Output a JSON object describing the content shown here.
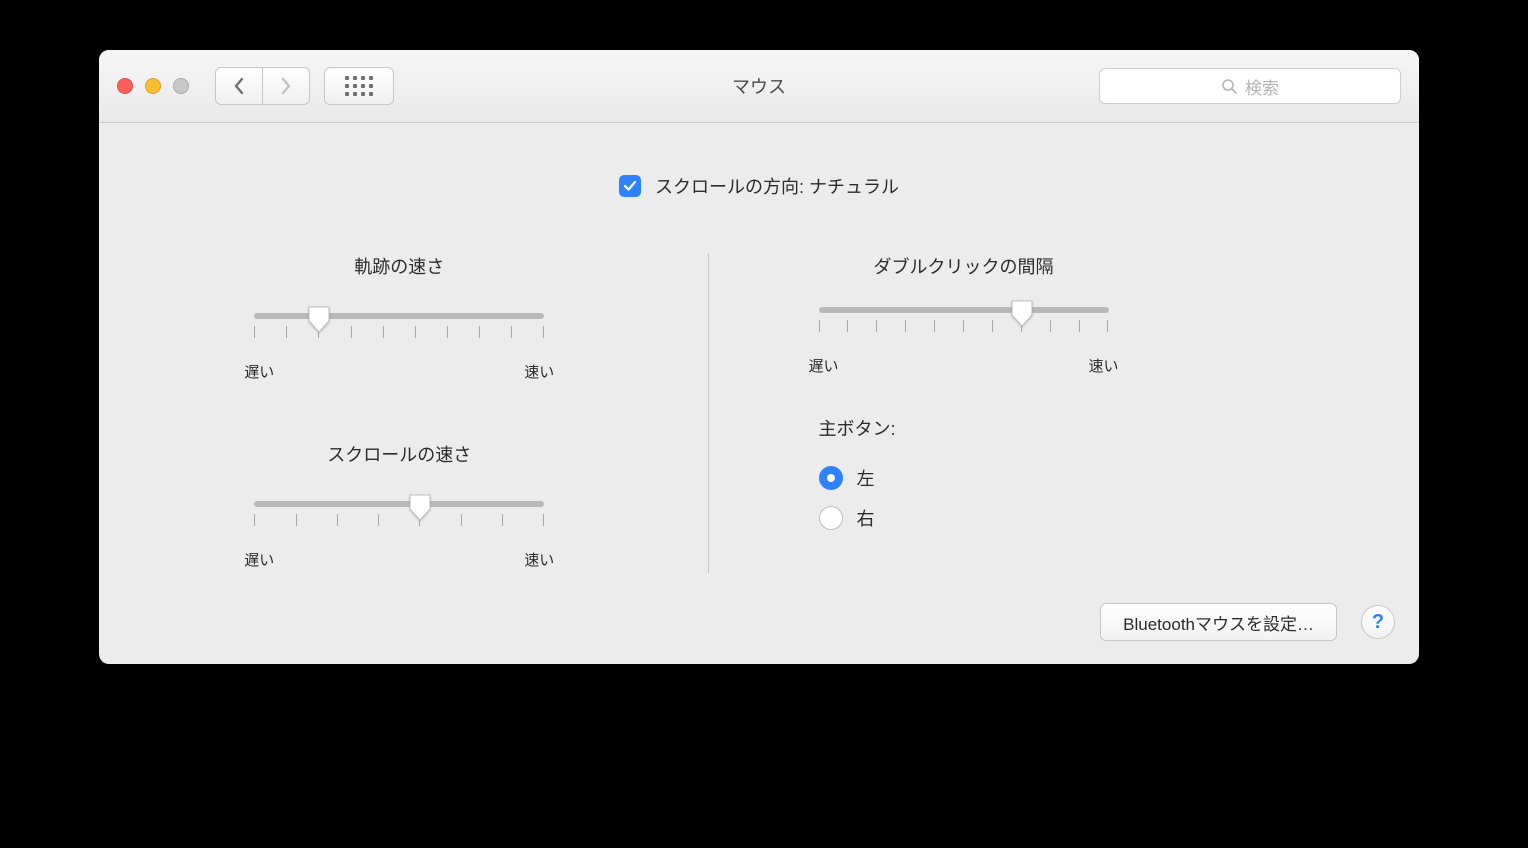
{
  "title": "マウス",
  "search": {
    "placeholder": "検索"
  },
  "scroll_direction": {
    "label": "スクロールの方向: ナチュラル",
    "checked": true
  },
  "tracking": {
    "title": "軌跡の速さ",
    "slow": "遅い",
    "fast": "速い",
    "ticks": 10,
    "value": 3
  },
  "scrolling": {
    "title": "スクロールの速さ",
    "slow": "遅い",
    "fast": "速い",
    "ticks": 8,
    "value": 5
  },
  "doubleclick": {
    "title": "ダブルクリックの間隔",
    "slow": "遅い",
    "fast": "速い",
    "ticks": 11,
    "value": 8
  },
  "primary": {
    "title": "主ボタン:",
    "left": "左",
    "right": "右",
    "selected": "left"
  },
  "footer": {
    "bluetooth": "Bluetoothマウスを設定…"
  }
}
